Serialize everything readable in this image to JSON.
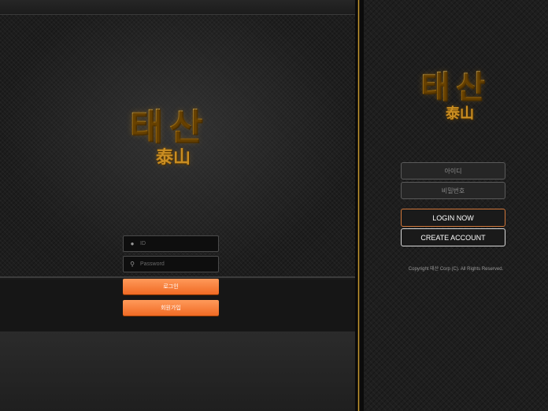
{
  "logo": {
    "hangul": "태산",
    "hanja": "泰山"
  },
  "left_form": {
    "id_placeholder": "ID",
    "password_placeholder": "Password",
    "login_label": "로그인",
    "signup_label": "회원가입"
  },
  "right_form": {
    "id_placeholder": "아이디",
    "password_placeholder": "비밀번호",
    "login_label": "LOGIN NOW",
    "create_label": "CREATE ACCOUNT",
    "copyright": "Copyright 태산 Corp (C). All Rights Reserved."
  },
  "icons": {
    "id_field": "user-icon",
    "password_field": "key-icon"
  },
  "colors": {
    "accent_orange": "#f57a36",
    "gold": "#e9b53a",
    "divider_gold": "#c69a34"
  }
}
